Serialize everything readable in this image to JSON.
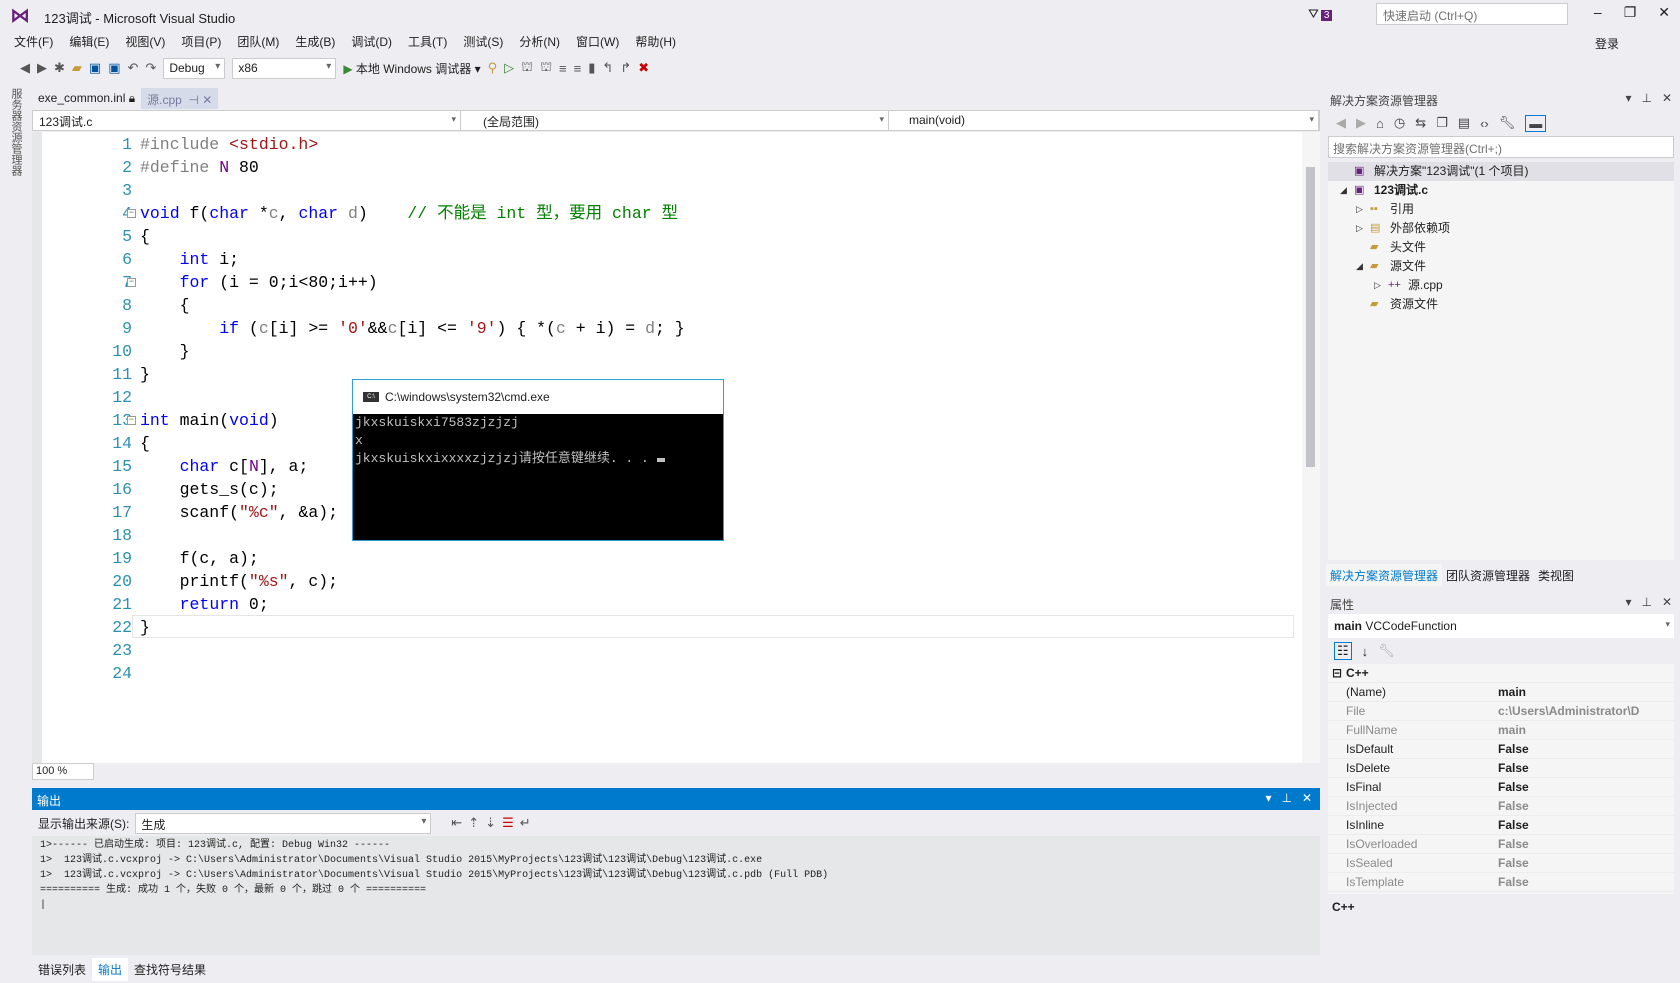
{
  "window": {
    "title": "123调试 - Microsoft Visual Studio",
    "quick_launch_placeholder": "快速启动 (Ctrl+Q)",
    "notification_count": "3",
    "login": "登录"
  },
  "menu": [
    "文件(F)",
    "编辑(E)",
    "视图(V)",
    "项目(P)",
    "团队(M)",
    "生成(B)",
    "调试(D)",
    "工具(T)",
    "测试(S)",
    "分析(N)",
    "窗口(W)",
    "帮助(H)"
  ],
  "toolbar": {
    "config": "Debug",
    "platform": "x86",
    "run_label": "本地 Windows 调试器"
  },
  "side_strip": "服务器资源管理器",
  "doc_tabs": [
    {
      "label": "exe_common.inl"
    },
    {
      "label": "源.cpp"
    }
  ],
  "navbar": {
    "project": "123调试.c",
    "scope": "(全局范围)",
    "member": "main(void)"
  },
  "editor": {
    "zoom": "100 %",
    "lines": [
      [
        [
          "#include",
          "pp"
        ],
        [
          " <stdio.h>",
          "str"
        ]
      ],
      [
        [
          "#define",
          "pp"
        ],
        [
          " ",
          "tx"
        ],
        [
          "N",
          "mac"
        ],
        [
          " 80",
          "tx"
        ]
      ],
      [],
      [
        [
          "void",
          "kw"
        ],
        [
          " f(",
          "tx"
        ],
        [
          "char",
          "kw"
        ],
        [
          " *",
          "tx"
        ],
        [
          "c",
          "pa"
        ],
        [
          ", ",
          "tx"
        ],
        [
          "char",
          "kw"
        ],
        [
          " ",
          "tx"
        ],
        [
          "d",
          "pa"
        ],
        [
          ")    ",
          "tx"
        ],
        [
          "// 不能是 int 型，要用 char 型",
          "cm"
        ]
      ],
      [
        [
          "{",
          "tx"
        ]
      ],
      [
        [
          "    ",
          "tx"
        ],
        [
          "int",
          "kw"
        ],
        [
          " i;",
          "tx"
        ]
      ],
      [
        [
          "    ",
          "tx"
        ],
        [
          "for",
          "kw"
        ],
        [
          " (i = 0;i<80;i++)",
          "tx"
        ]
      ],
      [
        [
          "    {",
          "tx"
        ]
      ],
      [
        [
          "        ",
          "tx"
        ],
        [
          "if",
          "kw"
        ],
        [
          " (",
          "tx"
        ],
        [
          "c",
          "pa"
        ],
        [
          "[i] >= ",
          "tx"
        ],
        [
          "'0'",
          "str"
        ],
        [
          "&&",
          "tx"
        ],
        [
          "c",
          "pa"
        ],
        [
          "[i] <= ",
          "tx"
        ],
        [
          "'9'",
          "str"
        ],
        [
          ") { *(",
          "tx"
        ],
        [
          "c",
          "pa"
        ],
        [
          " + i) = ",
          "tx"
        ],
        [
          "d",
          "pa"
        ],
        [
          "; }",
          "tx"
        ]
      ],
      [
        [
          "    }",
          "tx"
        ]
      ],
      [
        [
          "}",
          "tx"
        ]
      ],
      [],
      [
        [
          "int",
          "kw"
        ],
        [
          " main(",
          "tx"
        ],
        [
          "void",
          "kw"
        ],
        [
          ")",
          "tx"
        ]
      ],
      [
        [
          "{",
          "tx"
        ]
      ],
      [
        [
          "    ",
          "tx"
        ],
        [
          "char",
          "kw"
        ],
        [
          " c[",
          "tx"
        ],
        [
          "N",
          "mac"
        ],
        [
          "], a;",
          "tx"
        ]
      ],
      [
        [
          "    gets_s(c);",
          "tx"
        ]
      ],
      [
        [
          "    scanf(",
          "tx"
        ],
        [
          "\"%c\"",
          "str"
        ],
        [
          ", &a);",
          "tx"
        ]
      ],
      [],
      [
        [
          "    f(c, a);",
          "tx"
        ]
      ],
      [
        [
          "    printf(",
          "tx"
        ],
        [
          "\"%s\"",
          "str"
        ],
        [
          ", c);",
          "tx"
        ]
      ],
      [
        [
          "    ",
          "tx"
        ],
        [
          "return",
          "kw"
        ],
        [
          " 0;",
          "tx"
        ]
      ],
      [
        [
          "}",
          "tx"
        ]
      ],
      [],
      []
    ]
  },
  "console": {
    "title": "C:\\windows\\system32\\cmd.exe",
    "lines": [
      "jkxskuiskxi7583zjzjzj",
      "x",
      "jkxskuiskxixxxxzjzjzj请按任意键继续. . ."
    ]
  },
  "output": {
    "title": "输出",
    "source_label": "显示输出来源(S):",
    "source_value": "生成",
    "lines": [
      "1>------ 已启动生成: 项目: 123调试.c, 配置: Debug Win32 ------",
      "1>  123调试.c.vcxproj -> C:\\Users\\Administrator\\Documents\\Visual Studio 2015\\MyProjects\\123调试\\123调试\\Debug\\123调试.c.exe",
      "1>  123调试.c.vcxproj -> C:\\Users\\Administrator\\Documents\\Visual Studio 2015\\MyProjects\\123调试\\123调试\\Debug\\123调试.c.pdb (Full PDB)",
      "========== 生成: 成功 1 个，失败 0 个，最新 0 个，跳过 0 个 =========="
    ]
  },
  "bottom_tabs": [
    "错误列表",
    "输出",
    "查找符号结果"
  ],
  "solution_explorer": {
    "title": "解决方案资源管理器",
    "search_placeholder": "搜索解决方案资源管理器(Ctrl+;)",
    "tree": [
      {
        "label": "解决方案\"123调试\"(1 个项目)",
        "level": 0,
        "arrow": ""
      },
      {
        "label": "123调试.c",
        "level": 1,
        "arrow": "◢"
      },
      {
        "label": "引用",
        "level": 2,
        "arrow": "▷"
      },
      {
        "label": "外部依赖项",
        "level": 2,
        "arrow": "▷"
      },
      {
        "label": "头文件",
        "level": 2,
        "arrow": ""
      },
      {
        "label": "源文件",
        "level": 2,
        "arrow": "◢"
      },
      {
        "label": "源.cpp",
        "level": 3,
        "arrow": "▷"
      },
      {
        "label": "资源文件",
        "level": 2,
        "arrow": ""
      }
    ],
    "tabs": [
      "解决方案资源管理器",
      "团队资源管理器",
      "类视图"
    ]
  },
  "properties": {
    "title": "属性",
    "object_name": "main",
    "object_type": "VCCodeFunction",
    "category": "C++",
    "rows": [
      {
        "name": "(Name)",
        "value": "main",
        "dim": false
      },
      {
        "name": "File",
        "value": "c:\\Users\\Administrator\\D",
        "dim": true
      },
      {
        "name": "FullName",
        "value": "main",
        "dim": true
      },
      {
        "name": "IsDefault",
        "value": "False",
        "dim": false
      },
      {
        "name": "IsDelete",
        "value": "False",
        "dim": false
      },
      {
        "name": "IsFinal",
        "value": "False",
        "dim": false
      },
      {
        "name": "IsInjected",
        "value": "False",
        "dim": true
      },
      {
        "name": "IsInline",
        "value": "False",
        "dim": false
      },
      {
        "name": "IsOverloaded",
        "value": "False",
        "dim": true
      },
      {
        "name": "IsSealed",
        "value": "False",
        "dim": true
      },
      {
        "name": "IsTemplate",
        "value": "False",
        "dim": true
      }
    ],
    "description": "C++"
  },
  "colors": {
    "accent": "#007acc",
    "vs_purple": "#68217a",
    "keyword": "#0000ff",
    "comment": "#008000",
    "string": "#a31515",
    "line_number": "#2b91af"
  }
}
